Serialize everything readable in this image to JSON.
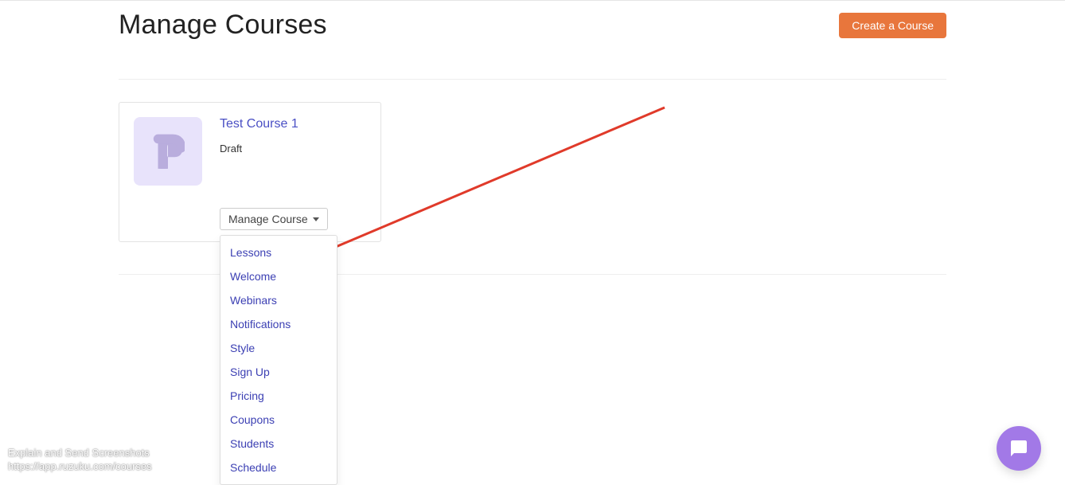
{
  "header": {
    "title": "Manage Courses",
    "create_button": "Create a Course"
  },
  "course": {
    "title": "Test Course 1",
    "status": "Draft",
    "dropdown_label": "Manage Course",
    "menu_items": [
      "Lessons",
      "Welcome",
      "Webinars",
      "Notifications",
      "Style",
      "Sign Up",
      "Pricing",
      "Coupons",
      "Students",
      "Schedule"
    ]
  },
  "watermark": {
    "line1": "Explain and Send Screenshots",
    "line2": "https://app.ruzuku.com/courses"
  }
}
